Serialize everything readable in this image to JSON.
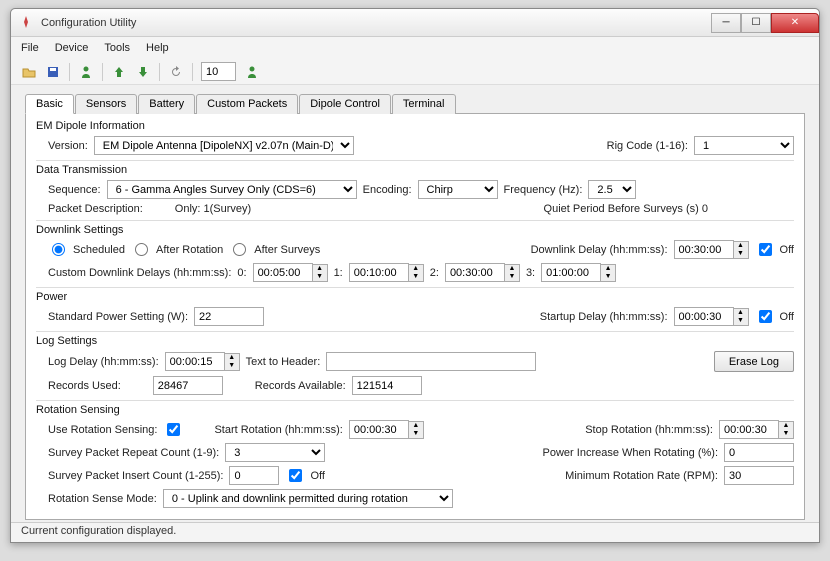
{
  "window": {
    "title": "Configuration Utility"
  },
  "menu": {
    "file": "File",
    "device": "Device",
    "tools": "Tools",
    "help": "Help"
  },
  "toolbar": {
    "spin_value": "10"
  },
  "tabs": [
    "Basic",
    "Sensors",
    "Battery",
    "Custom Packets",
    "Dipole Control",
    "Terminal"
  ],
  "dipole": {
    "group": "EM Dipole Information",
    "version_label": "Version:",
    "version_value": "EM Dipole Antenna [DipoleNX] v2.07n (Main-D)",
    "rig_label": "Rig Code (1-16):",
    "rig_value": "1"
  },
  "datatrans": {
    "group": "Data Transmission",
    "seq_label": "Sequence:",
    "seq_value": "6 - Gamma Angles Survey Only (CDS=6)",
    "enc_label": "Encoding:",
    "enc_value": "Chirp",
    "freq_label": "Frequency (Hz):",
    "freq_value": "2.5",
    "pkt_desc_label": "Packet Description:",
    "pkt_desc_value": "Only: 1(Survey)",
    "quiet_label": "Quiet Period Before Surveys (s) 0"
  },
  "downlink": {
    "group": "Downlink Settings",
    "scheduled": "Scheduled",
    "after_rot": "After Rotation",
    "after_surv": "After Surveys",
    "delay_label": "Downlink Delay (hh:mm:ss):",
    "delay_value": "00:30:00",
    "off": "Off",
    "custom_label": "Custom Downlink Delays (hh:mm:ss):",
    "d0l": "0:",
    "d0": "00:05:00",
    "d1l": "1:",
    "d1": "00:10:00",
    "d2l": "2:",
    "d2": "00:30:00",
    "d3l": "3:",
    "d3": "01:00:00"
  },
  "power": {
    "group": "Power",
    "std_label": "Standard Power Setting (W):",
    "std_value": "22",
    "startup_label": "Startup Delay (hh:mm:ss):",
    "startup_value": "00:00:30",
    "off": "Off"
  },
  "log": {
    "group": "Log Settings",
    "delay_label": "Log Delay (hh:mm:ss):",
    "delay_value": "00:00:15",
    "text_label": "Text to Header:",
    "text_value": "",
    "erase": "Erase Log",
    "used_label": "Records Used:",
    "used_value": "28467",
    "avail_label": "Records Available:",
    "avail_value": "121514"
  },
  "rot": {
    "group": "Rotation Sensing",
    "use_label": "Use Rotation Sensing:",
    "start_label": "Start Rotation (hh:mm:ss):",
    "start_value": "00:00:30",
    "stop_label": "Stop Rotation (hh:mm:ss):",
    "stop_value": "00:00:30",
    "repeat_label": "Survey Packet Repeat Count (1-9):",
    "repeat_value": "3",
    "power_inc_label": "Power Increase When Rotating (%):",
    "power_inc_value": "0",
    "insert_label": "Survey Packet Insert Count (1-255):",
    "insert_value": "0",
    "off": "Off",
    "min_rpm_label": "Minimum Rotation Rate (RPM):",
    "min_rpm_value": "30",
    "mode_label": "Rotation Sense Mode:",
    "mode_value": "0 - Uplink and downlink permitted during rotation"
  },
  "status": "Current configuration displayed."
}
